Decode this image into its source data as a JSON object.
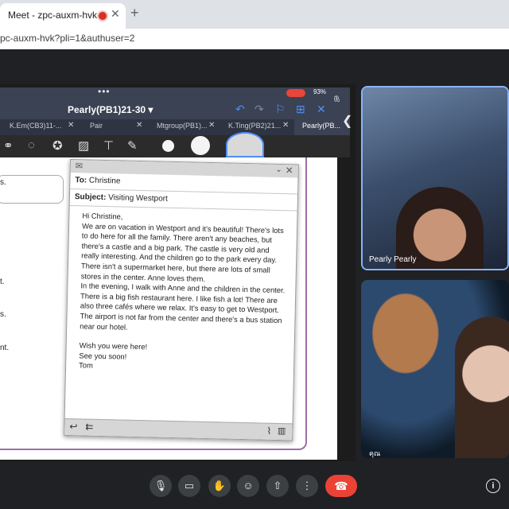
{
  "browser": {
    "tab_title": "Meet - zpc-auxm-hvk",
    "tab_close": "✕",
    "new_tab": "+",
    "url": "pc-auxm-hvk?pli=1&authuser=2"
  },
  "tablet": {
    "dots": "•••",
    "status": "93%",
    "doc_title": "Pearly(PB1)21-30 ▾",
    "tabs": [
      "K.Em(CB3)11-...",
      "Pair",
      "Mtgroup(PB1)...",
      "K.Ting(PB2)21...",
      "Pearly(PB..."
    ],
    "page_fragments": [
      "s.",
      "t.",
      "s.",
      "nt."
    ]
  },
  "email": {
    "to_label": "To:",
    "to_value": "Christine",
    "subject_label": "Subject:",
    "subject_value": "Visiting Westport",
    "greeting": "Hi Christine,",
    "paragraph1": "We are on vacation in Westport and it's beautiful! There's lots to do here for all the family. There aren't any beaches, but there's a castle and a big park. The castle is very old and really interesting. And the children go to the park every day. There isn't a supermarket here, but there are lots of small stores in the center. Anne loves them.",
    "paragraph2": "In the evening, I walk with Anne and the children in the center. There is a big fish restaurant here. I like fish a lot! There are also three cafés where we relax. It's easy to get to Westport. The airport is not far from the center and there's a bus station near our hotel.",
    "closing1": "Wish you were here!",
    "closing2": "See you soon!",
    "signature": "Tom"
  },
  "participants": [
    {
      "name": "Pearly Pearly"
    },
    {
      "name": "คุณ"
    }
  ],
  "controls": {
    "collapse": "❮",
    "info": "i"
  }
}
